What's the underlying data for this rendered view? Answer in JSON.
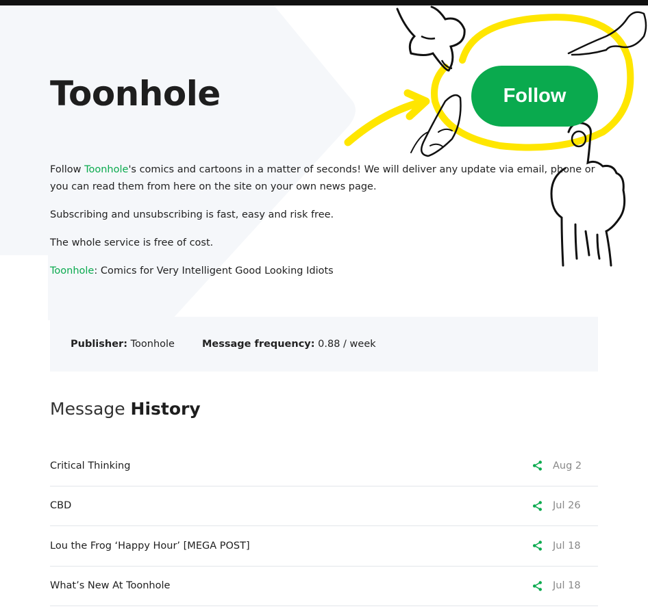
{
  "colors": {
    "accent": "#0aaa4e",
    "highlight": "#ffe600",
    "top_bar": "#111111",
    "panel_bg": "#f5f7fa"
  },
  "header": {
    "title": "Toonhole",
    "follow_label": "Follow"
  },
  "description": {
    "p1_prefix": "Follow ",
    "p1_link": "Toonhole",
    "p1_suffix": "'s comics and cartoons in a matter of seconds! We will deliver any update via email, phone or you can read them from here on the site on your own news page.",
    "p2": "Subscribing and unsubscribing is fast, easy and risk free.",
    "p3": "The whole service is free of cost.",
    "p4_link": "Toonhole",
    "p4_suffix": ": Comics for Very Intelligent Good Looking Idiots"
  },
  "info": {
    "publisher_label": "Publisher:",
    "publisher_value": "Toonhole",
    "frequency_label": "Message frequency:",
    "frequency_value": "0.88 / week"
  },
  "history": {
    "title_light": "Message ",
    "title_bold": "History",
    "items": [
      {
        "title": "Critical Thinking",
        "date": "Aug 2",
        "icon": "share-icon"
      },
      {
        "title": "CBD",
        "date": "Jul 26",
        "icon": "share-icon"
      },
      {
        "title": "Lou the Frog ‘Happy Hour’ [MEGA POST]",
        "date": "Jul 18",
        "icon": "share-icon"
      },
      {
        "title": "What’s New At Toonhole",
        "date": "Jul 18",
        "icon": "share-icon"
      }
    ]
  }
}
